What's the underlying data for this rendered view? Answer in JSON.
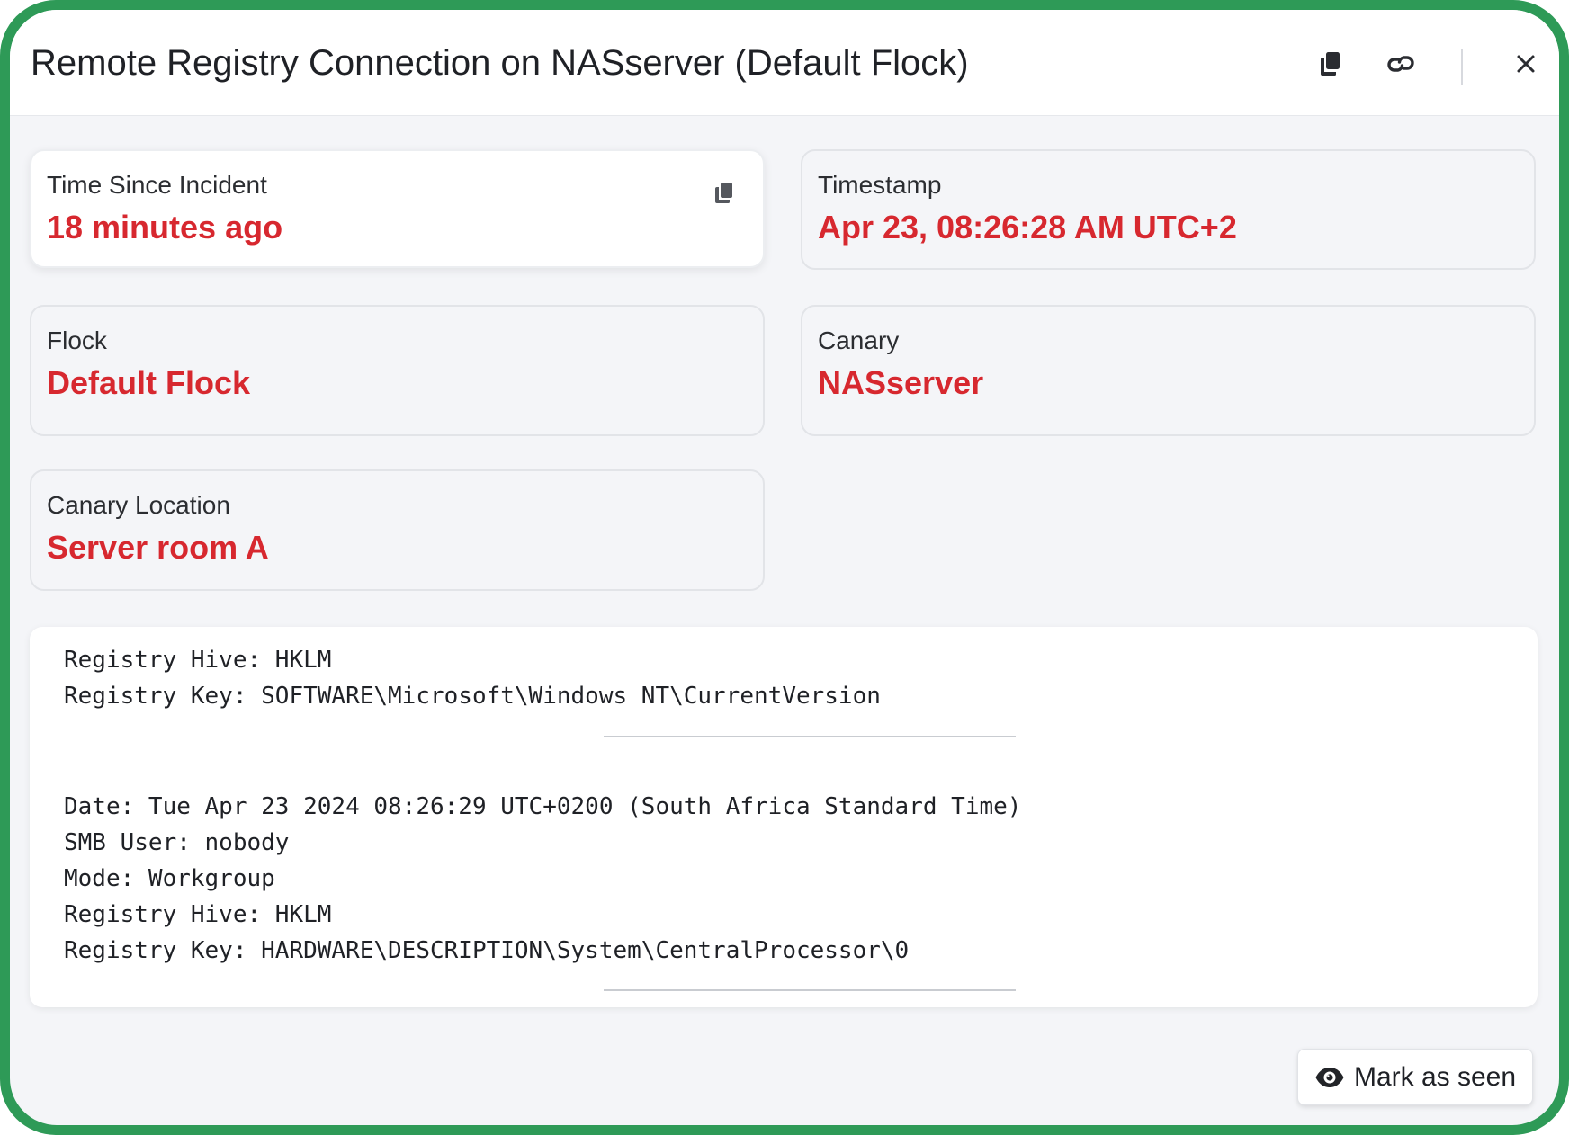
{
  "window": {
    "title": "Remote Registry Connection on NASserver (Default Flock)"
  },
  "toolbar": {
    "icons": [
      "copy-icon",
      "link-icon",
      "close-icon"
    ]
  },
  "cards": {
    "time_since": {
      "label": "Time Since Incident",
      "value": "18 minutes ago"
    },
    "timestamp": {
      "label": "Timestamp",
      "value": "Apr 23, 08:26:28 AM UTC+2"
    },
    "flock": {
      "label": "Flock",
      "value": "Default Flock"
    },
    "canary": {
      "label": "Canary",
      "value": "NASserver"
    },
    "location": {
      "label": "Canary Location",
      "value": "Server room A"
    }
  },
  "log": {
    "entry1": {
      "hive": "Registry Hive: HKLM",
      "key": "Registry Key: SOFTWARE\\Microsoft\\Windows NT\\CurrentVersion"
    },
    "entry2": {
      "date": "Date: Tue Apr 23 2024 08:26:29 UTC+0200 (South Africa Standard Time)",
      "user": "SMB User: nobody",
      "mode": "Mode: Workgroup",
      "hive": "Registry Hive: HKLM",
      "key": "Registry Key: HARDWARE\\DESCRIPTION\\System\\CentralProcessor\\0"
    }
  },
  "actions": {
    "mark_seen": "Mark as seen"
  },
  "colors": {
    "accent_red": "#d7282f",
    "frame_green": "#2e9a57"
  }
}
